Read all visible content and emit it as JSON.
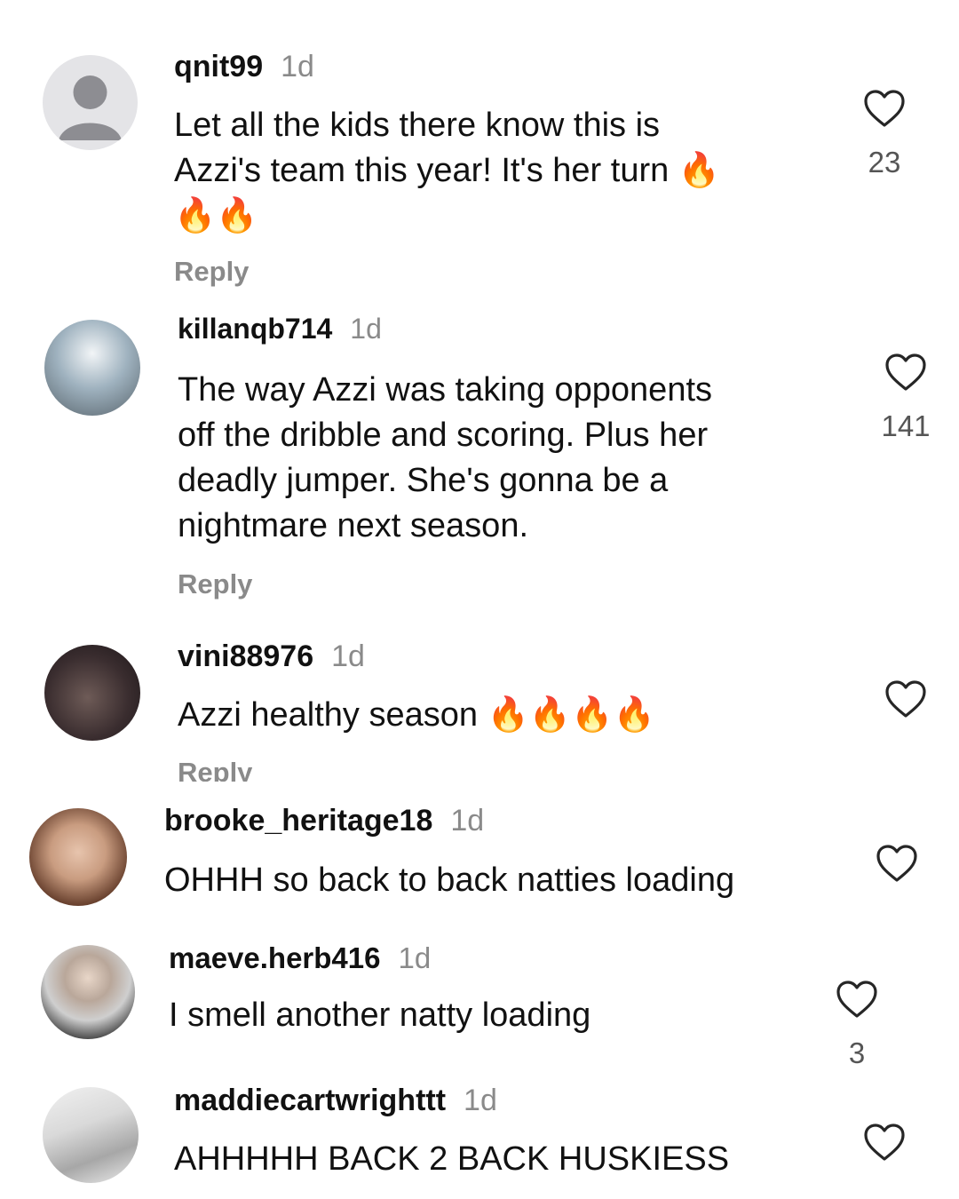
{
  "comments": [
    {
      "username": "qnit99",
      "time": "1d",
      "text": "Let all the kids there know this is\nAzzi's team this year! It's her turn 🔥\n🔥🔥",
      "reply_label": "Reply",
      "likes": "23"
    },
    {
      "username": "killanqb714",
      "time": "1d",
      "text": "The way Azzi was taking opponents\noff the dribble  and scoring. Plus her\ndeadly jumper. She's gonna be a\nnightmare  next season.",
      "reply_label": "Reply",
      "likes": "141"
    },
    {
      "username": "vini88976",
      "time": "1d",
      "text": "Azzi healthy season 🔥🔥🔥🔥",
      "reply_label": "Reply",
      "likes": ""
    },
    {
      "username": "brooke_heritage18",
      "time": "1d",
      "text": "OHHH so back to back natties loading",
      "reply_label": "",
      "likes": ""
    },
    {
      "username": "maeve.herb416",
      "time": "1d",
      "text": "I smell another natty loading",
      "reply_label": "",
      "likes": "3"
    },
    {
      "username": "maddiecartwrighttt",
      "time": "1d",
      "text": "AHHHHH BACK 2 BACK HUSKIESS",
      "reply_label": "",
      "likes": ""
    }
  ],
  "colors": {
    "username": "#111111",
    "timestamp": "#8a8a8a",
    "reply": "#8a8a8a",
    "heart_stroke": "#262626",
    "like_count": "#555555"
  },
  "icons": {
    "like": "heart-outline-icon",
    "default_avatar": "person-icon"
  }
}
